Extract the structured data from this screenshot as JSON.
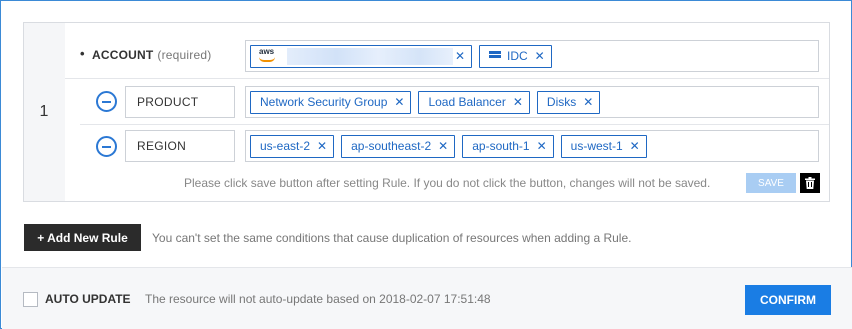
{
  "rule": {
    "number": "1",
    "account": {
      "label": "ACCOUNT",
      "required": "(required)",
      "tags": [
        {
          "type": "aws",
          "logo_text": "aws",
          "value": ""
        },
        {
          "type": "idc",
          "value": "IDC"
        }
      ]
    },
    "conditions": [
      {
        "label": "PRODUCT",
        "tags": [
          "Network Security Group",
          "Load Balancer",
          "Disks"
        ]
      },
      {
        "label": "REGION",
        "tags": [
          "us-east-2",
          "ap-southeast-2",
          "ap-south-1",
          "us-west-1"
        ]
      }
    ],
    "hint": "Please click save button after setting Rule. If you do not click the button, changes will not be saved.",
    "save_label": "SAVE"
  },
  "add_rule": {
    "label": "+ Add New Rule",
    "hint": "You can't set the same conditions that cause duplication of resources when adding a Rule."
  },
  "footer": {
    "auto_update_label": "AUTO UPDATE",
    "auto_update_checked": false,
    "auto_update_desc": "The resource will not auto-update based on 2018-02-07 17:51:48",
    "confirm_label": "CONFIRM"
  },
  "colors": {
    "accent": "#1a7de4",
    "tag": "#1f68c3",
    "save_disabled": "#a9cdf3"
  },
  "icons": {
    "remove_tag": "close-icon",
    "remove_condition": "minus-circle-icon",
    "delete_rule": "trash-icon",
    "idc": "server-icon"
  }
}
